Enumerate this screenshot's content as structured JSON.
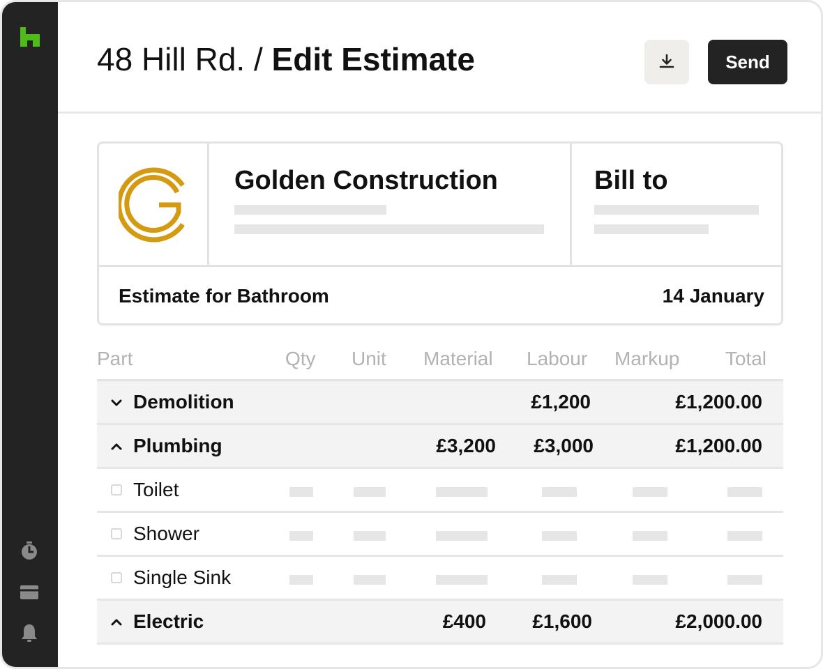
{
  "header": {
    "breadcrumb": "48 Hill Rd.",
    "separator": "/",
    "page_title": "Edit Estimate",
    "download_icon": "download-icon",
    "send_label": "Send"
  },
  "sidebar": {
    "logo_icon": "houzz-logo-icon",
    "brand_color": "#4dbc15",
    "items": [
      {
        "icon": "timer-icon"
      },
      {
        "icon": "inbox-icon"
      },
      {
        "icon": "bell-icon"
      }
    ]
  },
  "estimate_card": {
    "logo_icon": "golden-construction-logo-icon",
    "logo_color": "#d49a12",
    "company_name": "Golden Construction",
    "bill_to_label": "Bill to",
    "estimate_for": "Estimate for Bathroom",
    "date": "14 January"
  },
  "table": {
    "columns": [
      "Part",
      "Qty",
      "Unit",
      "Material",
      "Labour",
      "Markup",
      "Total"
    ],
    "rows": [
      {
        "type": "group",
        "expanded": false,
        "part": "Demolition",
        "material": "",
        "labour": "£1,200",
        "total": "£1,200.00"
      },
      {
        "type": "group",
        "expanded": true,
        "part": "Plumbing",
        "material": "£3,200",
        "labour": "£3,000",
        "total": "£1,200.00"
      },
      {
        "type": "item",
        "part": "Toilet"
      },
      {
        "type": "item",
        "part": "Shower"
      },
      {
        "type": "item",
        "part": "Single Sink"
      },
      {
        "type": "group",
        "expanded": true,
        "part": "Electric",
        "material": "£400",
        "labour": "£1,600",
        "total": "£2,000.00"
      }
    ]
  }
}
